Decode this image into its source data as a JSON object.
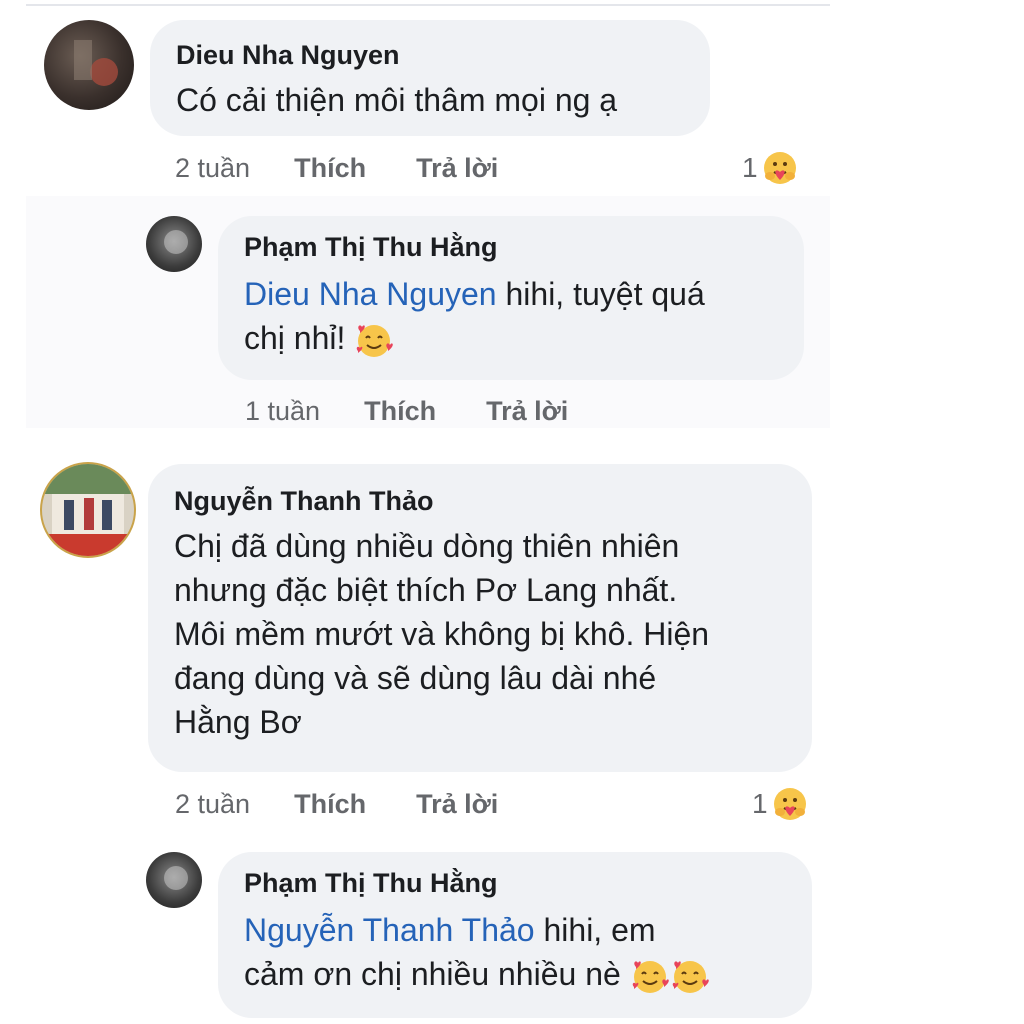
{
  "comments": [
    {
      "author": "Dieu Nha Nguyen",
      "text": "Có cải thiện môi thâm mọi ng ạ",
      "time": "2 tuần",
      "like_label": "Thích",
      "reply_label": "Trả lời",
      "reaction_count": "1",
      "reply": {
        "author": "Phạm Thị Thu Hằng",
        "mention": "Dieu Nha Nguyen",
        "text_line1": " hihi, tuyệt quá",
        "text_line2": "chị nhỉ!",
        "time": "1 tuần",
        "like_label": "Thích",
        "reply_label": "Trả lời"
      }
    },
    {
      "author": "Nguyễn Thanh Thảo",
      "lines": [
        "Chị đã dùng nhiều dòng thiên nhiên",
        "nhưng đặc biệt thích Pơ Lang nhất.",
        "Môi mềm mướt và không bị khô. Hiện",
        "đang dùng và sẽ dùng lâu dài nhé",
        "Hằng Bơ"
      ],
      "time": "2 tuần",
      "like_label": "Thích",
      "reply_label": "Trả lời",
      "reaction_count": "1",
      "reply": {
        "author": "Phạm Thị Thu Hằng",
        "mention": "Nguyễn Thanh Thảo",
        "text_line1": " hihi, em",
        "text_line2": "cảm ơn chị nhiều nhiều nè"
      }
    }
  ],
  "icons": {
    "care_reaction": "care-emoji",
    "smiling_hearts": "smiling-face-with-hearts"
  },
  "colors": {
    "bubble": "#f0f2f5",
    "mention": "#2563b8",
    "meta": "#65676b"
  }
}
